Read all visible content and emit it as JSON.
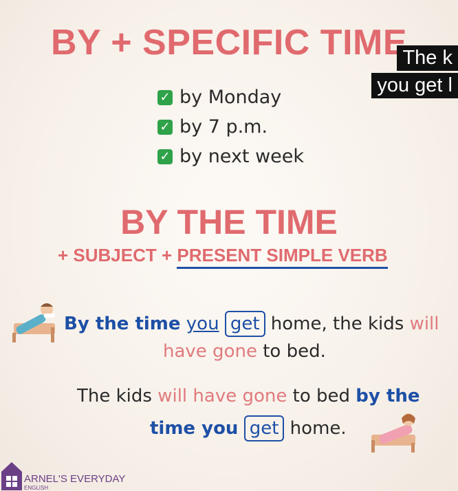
{
  "heading": "BY + SPECIFIC TIME",
  "checklist": [
    {
      "text": "by Monday"
    },
    {
      "text": "by 7 p.m."
    },
    {
      "text": "by next week"
    }
  ],
  "check_mark": "✓",
  "subheading": "BY THE TIME",
  "formula": {
    "prefix": "+ SUBJECT + ",
    "underlined": "PRESENT SIMPLE VERB"
  },
  "example1": {
    "part1": "By the time",
    "part2": "you",
    "part3": "get",
    "part4": " home, the kids ",
    "part5": "will",
    "part6": "have gone",
    "part7": " to bed."
  },
  "example2": {
    "part1": "The kids ",
    "part2": "will have gone",
    "part3": " to bed ",
    "part4": "by the",
    "part5": "time you",
    "part6": "get",
    "part7": " home."
  },
  "caption": {
    "line1": "The k",
    "line2": "you get l"
  },
  "logo": {
    "name": "ARNEL'S EVERYDAY",
    "sub": "ENGLISH"
  },
  "colors": {
    "accent_red": "#e06a6e",
    "accent_blue": "#1d4fa6",
    "check_green": "#2fa24a",
    "logo_purple": "#6b3f86"
  },
  "icons": [
    "sleeping-boy-icon",
    "sleeping-girl-icon",
    "house-logo-icon",
    "check-icon"
  ]
}
